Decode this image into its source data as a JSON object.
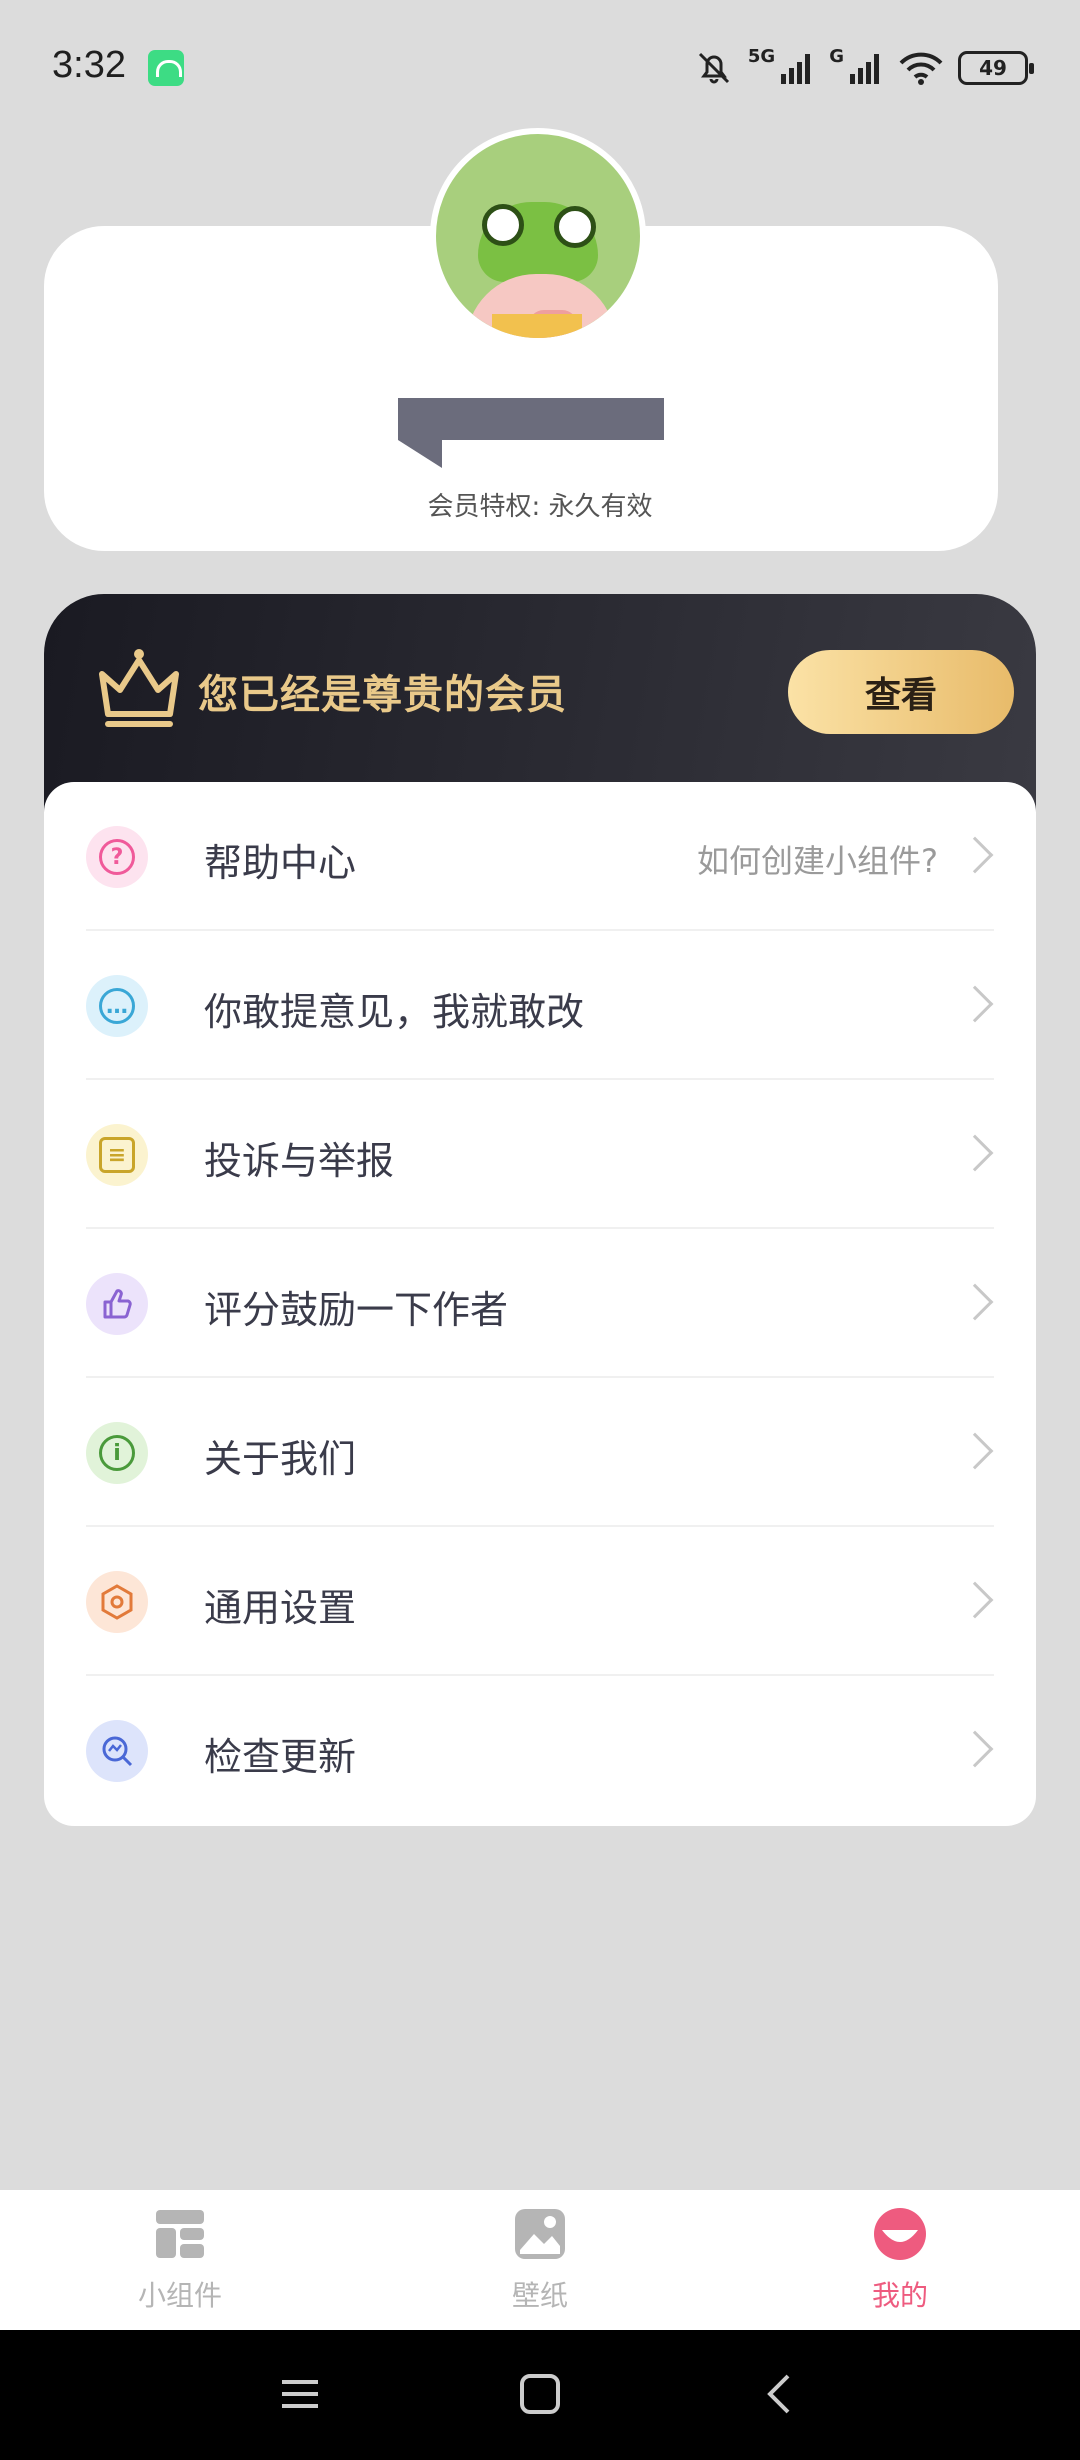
{
  "status_bar": {
    "time": "3:32",
    "network_1": "5G",
    "network_2": "G",
    "battery": "49"
  },
  "profile": {
    "vip_privilege": "会员特权: 永久有效"
  },
  "vip_banner": {
    "text": "您已经是尊贵的会员",
    "button_label": "查看"
  },
  "menu": [
    {
      "label": "帮助中心",
      "hint": "如何创建小组件?",
      "icon": "help-icon",
      "color": "#f05a9a",
      "bg": "#fde3ef"
    },
    {
      "label": "你敢提意见，我就敢改",
      "hint": "",
      "icon": "chat-icon",
      "color": "#3aa7d6",
      "bg": "#dcf1fb"
    },
    {
      "label": "投诉与举报",
      "hint": "",
      "icon": "report-icon",
      "color": "#c9a52a",
      "bg": "#fbf3cf"
    },
    {
      "label": "评分鼓励一下作者",
      "hint": "",
      "icon": "thumb-up-icon",
      "color": "#8a63d2",
      "bg": "#ece3fb"
    },
    {
      "label": "关于我们",
      "hint": "",
      "icon": "info-icon",
      "color": "#4a9a3b",
      "bg": "#e1f3d9"
    },
    {
      "label": "通用设置",
      "hint": "",
      "icon": "settings-icon",
      "color": "#e27a3a",
      "bg": "#fde6d7"
    },
    {
      "label": "检查更新",
      "hint": "",
      "icon": "update-icon",
      "color": "#4a68d6",
      "bg": "#dde4fb"
    }
  ],
  "bottom_nav": [
    {
      "label": "小组件",
      "icon": "widget-icon",
      "active": false
    },
    {
      "label": "壁纸",
      "icon": "wallpaper-icon",
      "active": false
    },
    {
      "label": "我的",
      "icon": "profile-icon",
      "active": true
    }
  ],
  "colors": {
    "accent": "#ee5b7f",
    "gold": "#e9c98a"
  }
}
